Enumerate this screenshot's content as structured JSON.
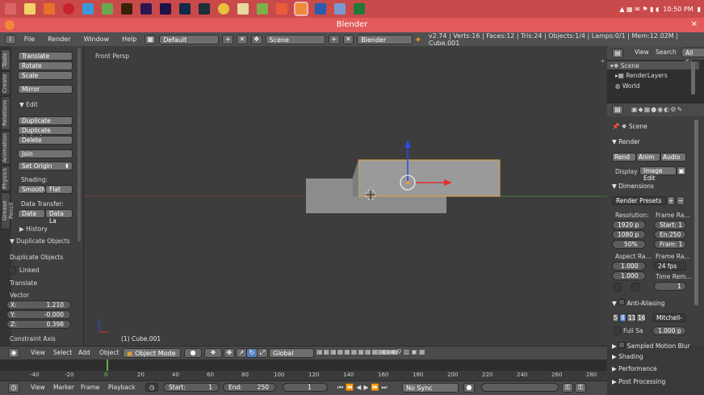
{
  "taskbar": {
    "clock": "10:50 PM"
  },
  "window": {
    "title": "Blender"
  },
  "info_header": {
    "menus": [
      "File",
      "Render",
      "Window",
      "Help"
    ],
    "layout": "Default",
    "scene": "Scene",
    "engine": "Blender Render",
    "stats": "v2.74 | Verts:16 | Faces:12 | Tris:24 | Objects:1/4 | Lamps:0/1 | Mem:12.02M | Cube.001"
  },
  "toolshelf": {
    "tabs": [
      "Tools",
      "Create",
      "Relations",
      "Animation",
      "Physics",
      "Grease Pencil"
    ],
    "transform": [
      "Translate",
      "Rotate",
      "Scale"
    ],
    "mirror": "Mirror",
    "edit_heading": "Edit",
    "edit": [
      "Duplicate",
      "Duplicate Linked",
      "Delete"
    ],
    "join": "Join",
    "set_origin": "Set Origin",
    "shading_label": "Shading:",
    "smooth": "Smooth",
    "flat": "Flat",
    "data_transfer_label": "Data Transfer:",
    "data": "Data",
    "data_layers": "Data La",
    "history": "History"
  },
  "operator": {
    "heading": "Duplicate Objects",
    "sub": "Duplicate Objects",
    "linked": "Linked",
    "translate": "Translate",
    "vector": "Vector",
    "x_label": "X:",
    "x": "1.210",
    "y_label": "Y:",
    "y": "-0.000",
    "z_label": "Z:",
    "z": "0.398",
    "constraint": "Constraint Axis"
  },
  "viewport": {
    "view_name": "Front Persp",
    "object_label": "(1) Cube.001"
  },
  "outliner": {
    "view": "View",
    "search": "Search",
    "all": "All Sc",
    "items": [
      "Scene",
      "RenderLayers",
      "World"
    ]
  },
  "properties": {
    "scene": "Scene",
    "render": "Render",
    "render_btn": "Rend",
    "anim_btn": "Anim",
    "audio_btn": "Audio",
    "display_label": "Display",
    "display_val": "Image Edit",
    "dimensions": "Dimensions",
    "presets": "Render Presets",
    "resolution_label": "Resolution:",
    "res_x": "1920 p",
    "res_y": "1080 p",
    "res_pct": "50%",
    "frame_range_label": "Frame Ra...",
    "start": "Start: 1",
    "end": "En:250",
    "frame": "Fram: 1",
    "aspect_label": "Aspect Ra...",
    "aspect_x": "1.000",
    "aspect_y": "1.000",
    "frame_rate_label": "Frame Ra...",
    "fps": "24 fps",
    "time_remap_label": "Time Rem...",
    "remap": "1",
    "anti_aliasing": "Anti-Aliasing",
    "aa_samples": [
      "5",
      "8",
      "11",
      "16"
    ],
    "aa_filter": "Mitchell-",
    "full_sample": "Full Sa",
    "filter_size": "1.000 p",
    "sampled_motion": "Sampled Motion Blur",
    "shading": "Shading",
    "performance": "Performance",
    "post_processing": "Post Processing"
  },
  "view_header": {
    "menus": [
      "View",
      "Select",
      "Add",
      "Object"
    ],
    "mode": "Object Mode",
    "orientation": "Global"
  },
  "timeline": {
    "ticks": [
      "-40",
      "-20",
      "0",
      "20",
      "40",
      "60",
      "80",
      "100",
      "120",
      "140",
      "160",
      "180",
      "200",
      "220",
      "240",
      "260",
      "280"
    ],
    "menus": [
      "View",
      "Marker",
      "Frame",
      "Playback"
    ],
    "start": "Start:",
    "start_val": "1",
    "end": "End:",
    "end_val": "250",
    "current": "1",
    "sync": "No Sync"
  },
  "colors": {
    "accent": "#e25a5a",
    "selected_outline": "#e8a23a",
    "x_axis": "#e23030",
    "z_axis": "#2a4de0"
  }
}
